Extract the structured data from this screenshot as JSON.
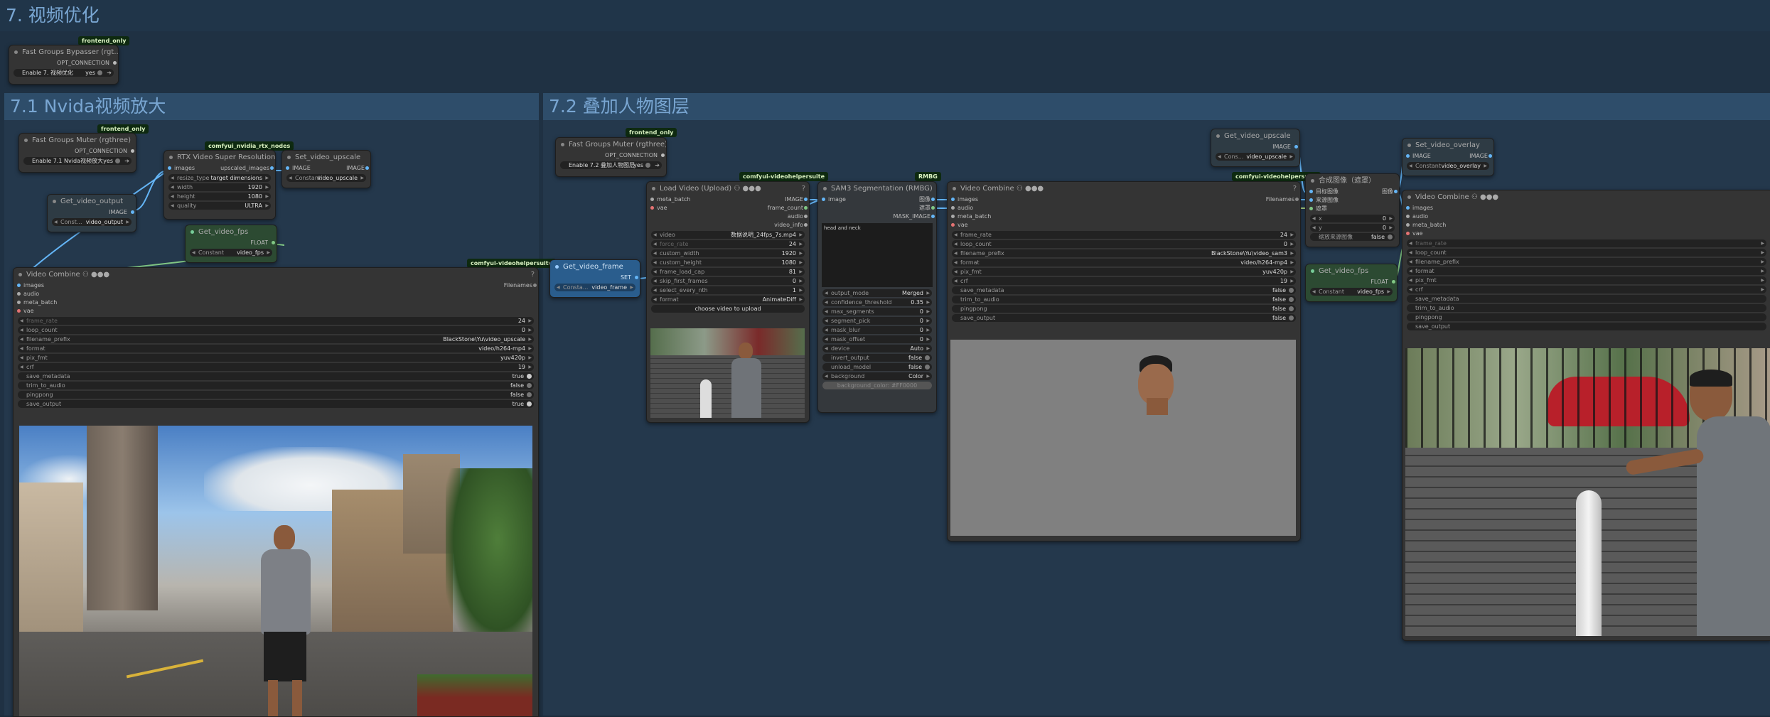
{
  "groups": {
    "g7": "7. 视频优化",
    "g71": "7.1 Nvida视频放大",
    "g72": "7.2 叠加人物图层"
  },
  "colors": {
    "canvas": "#1b2b3b",
    "group_bg": "#24384c",
    "group_title": "#79a6d2",
    "node_bg": "#343434",
    "badge_bg": "#0e2a10"
  },
  "fgb": {
    "badge": "frontend_only",
    "title": "Fast Groups Bypasser (rgt...",
    "out": "OPT_CONNECTION",
    "w_label": "Enable 7. 视频优化",
    "w_val": "yes"
  },
  "fgm1": {
    "badge": "frontend_only",
    "title": "Fast Groups Muter (rgthree)",
    "out": "OPT_CONNECTION",
    "w_label": "Enable 7.1 Nvida视频放大",
    "w_val": "yes"
  },
  "fgm2": {
    "badge": "frontend_only",
    "title": "Fast Groups Muter (rgthree)",
    "out": "OPT_CONNECTION",
    "w_label": "Enable 7.2 叠加人物图层",
    "w_val": "yes"
  },
  "rtx": {
    "badge": "comfyui_nvidia_rtx_nodes",
    "title": "RTX Video Super Resolution",
    "in": "images",
    "out": "upscaled_images",
    "w": [
      {
        "k": "resize_type",
        "v": "target dimensions"
      },
      {
        "k": "width",
        "v": "1920"
      },
      {
        "k": "height",
        "v": "1080"
      },
      {
        "k": "quality",
        "v": "ULTRA"
      }
    ]
  },
  "set_up": {
    "title": "Set_video_upscale",
    "in": "IMAGE",
    "out": "IMAGE",
    "w_k": "Constant",
    "w_v": "video_upscale"
  },
  "get_out": {
    "title": "Get_video_output",
    "out": "IMAGE",
    "w_k": "Const...",
    "w_v": "video_output"
  },
  "get_fps1": {
    "title": "Get_video_fps",
    "out": "FLOAT",
    "w_k": "Constant",
    "w_v": "video_fps"
  },
  "vc1": {
    "badge": "comfyui-videohelpersuite",
    "title": "Video Combine",
    "ins": [
      "images",
      "audio",
      "meta_batch",
      "vae"
    ],
    "out": "Filenames",
    "w": [
      {
        "k": "frame_rate",
        "v": "24",
        "dim": true
      },
      {
        "k": "loop_count",
        "v": "0"
      },
      {
        "k": "filename_prefix",
        "v": "BlackStone\\Yu\\video_upscale"
      },
      {
        "k": "format",
        "v": "video/h264-mp4"
      },
      {
        "k": "pix_fmt",
        "v": "yuv420p"
      },
      {
        "k": "crf",
        "v": "19"
      }
    ],
    "t": [
      {
        "k": "save_metadata",
        "v": "true"
      },
      {
        "k": "trim_to_audio",
        "v": "false"
      },
      {
        "k": "pingpong",
        "v": "false"
      },
      {
        "k": "save_output",
        "v": "true"
      }
    ]
  },
  "get_frame": {
    "title": "Get_video_frame",
    "out": "SET",
    "w_k": "Consta...",
    "w_v": "video_frame"
  },
  "lv": {
    "badge": "comfyui-videohelpersuite",
    "title": "Load Video (Upload)",
    "ins": [
      "meta_batch",
      "vae"
    ],
    "outs": [
      "IMAGE",
      "frame_count",
      "audio",
      "video_info"
    ],
    "w": [
      {
        "k": "video",
        "v": "数据说明_24fps_7s.mp4"
      },
      {
        "k": "force_rate",
        "v": "24"
      },
      {
        "k": "custom_width",
        "v": "1920"
      },
      {
        "k": "custom_height",
        "v": "1080"
      },
      {
        "k": "frame_load_cap",
        "v": "81"
      },
      {
        "k": "skip_first_frames",
        "v": "0"
      },
      {
        "k": "select_every_nth",
        "v": "1"
      },
      {
        "k": "format",
        "v": "AnimateDiff"
      }
    ],
    "btn": "choose video to upload"
  },
  "sam": {
    "badge": "RMBG",
    "title": "SAM3 Segmentation (RMBG)",
    "in": "image",
    "outs": [
      "图像",
      "遮罩",
      "MASK_IMAGE"
    ],
    "prompt": "head and neck",
    "w": [
      {
        "k": "output_mode",
        "v": "Merged"
      },
      {
        "k": "confidence_threshold",
        "v": "0.35"
      },
      {
        "k": "max_segments",
        "v": "0"
      },
      {
        "k": "segment_pick",
        "v": "0"
      },
      {
        "k": "mask_blur",
        "v": "0"
      },
      {
        "k": "mask_offset",
        "v": "0"
      },
      {
        "k": "device",
        "v": "Auto"
      }
    ],
    "t": [
      {
        "k": "invert_output",
        "v": "false"
      },
      {
        "k": "unload_model",
        "v": "false"
      }
    ],
    "bg": {
      "k": "background",
      "v": "Color"
    },
    "bgc": "background_color: #FF0000"
  },
  "vc2": {
    "badge": "comfyui-videohelpersuite",
    "title": "Video Combine",
    "ins": [
      "images",
      "audio",
      "meta_batch",
      "vae"
    ],
    "out": "Filenames",
    "w": [
      {
        "k": "frame_rate",
        "v": "24"
      },
      {
        "k": "loop_count",
        "v": "0"
      },
      {
        "k": "filename_prefix",
        "v": "BlackStone\\Yu\\video_sam3"
      },
      {
        "k": "format",
        "v": "video/h264-mp4"
      },
      {
        "k": "pix_fmt",
        "v": "yuv420p"
      },
      {
        "k": "crf",
        "v": "19"
      }
    ],
    "t": [
      {
        "k": "save_metadata",
        "v": "false"
      },
      {
        "k": "trim_to_audio",
        "v": "false"
      },
      {
        "k": "pingpong",
        "v": "false"
      },
      {
        "k": "save_output",
        "v": "false"
      }
    ]
  },
  "get_up": {
    "title": "Get_video_upscale",
    "out": "IMAGE",
    "w_k": "Cons...",
    "w_v": "video_upscale"
  },
  "comp": {
    "title": "合成图像（遮罩）",
    "ins": [
      "目标图像",
      "来源图像",
      "遮罩"
    ],
    "out": "图像",
    "w": [
      {
        "k": "x",
        "v": "0"
      },
      {
        "k": "y",
        "v": "0"
      }
    ],
    "t": {
      "k": "缩放来源图像",
      "v": "false"
    }
  },
  "get_fps2": {
    "title": "Get_video_fps",
    "out": "FLOAT",
    "w_k": "Constant",
    "w_v": "video_fps"
  },
  "set_ov": {
    "title": "Set_video_overlay",
    "in": "IMAGE",
    "out": "IMAGE",
    "w_k": "Constant",
    "w_v": "video_overlay"
  },
  "vc3": {
    "title": "Video Combine",
    "ins": [
      "images",
      "audio",
      "meta_batch",
      "vae"
    ],
    "w": [
      "frame_rate",
      "loop_count",
      "filename_prefix",
      "format",
      "pix_fmt",
      "crf"
    ],
    "t": [
      "save_metadata",
      "trim_to_audio",
      "pingpong",
      "save_output"
    ]
  }
}
